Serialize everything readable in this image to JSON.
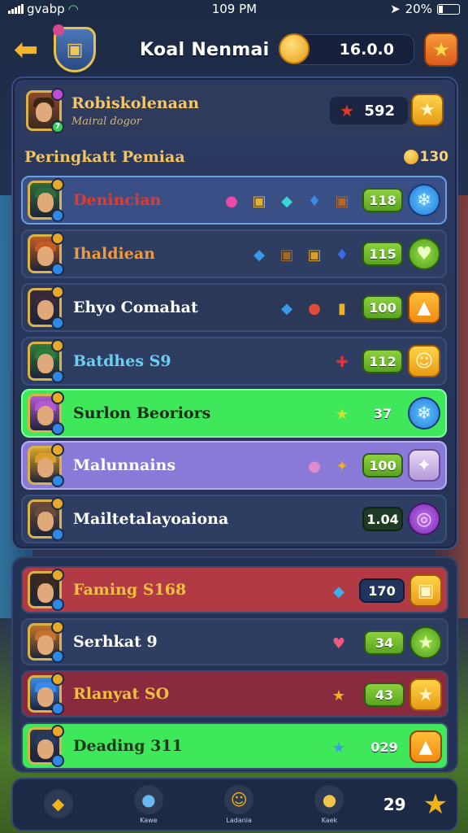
{
  "status_bar": {
    "carrier": "gvabp",
    "time": "109 PM",
    "battery": "20%"
  },
  "header": {
    "title": "Koal Nenmai",
    "coins": "16.0.0"
  },
  "player": {
    "name": "Robiskolenaan",
    "subtitle": "Mairal dogor",
    "score": "592"
  },
  "ranking": {
    "title": "Peringkatt Pemiaa",
    "count": "130"
  },
  "rows": [
    {
      "name": "Denincian",
      "value": "118",
      "name_color": "#e6392c",
      "row_bg": "#3a4f86",
      "border": "#6aa0e0",
      "button": "blue",
      "button_icon": "snowflake-icon",
      "button_glyph": "❄",
      "value_style": "green",
      "avatar_tone": "#2f6a3a",
      "items": [
        {
          "icon": "donut-icon",
          "glyph": "●",
          "color": "#e84aa8"
        },
        {
          "icon": "chest-icon",
          "glyph": "▣",
          "color": "#e0b23a"
        },
        {
          "icon": "cube-icon",
          "glyph": "◆",
          "color": "#3ad6d6"
        },
        {
          "icon": "gem-icon",
          "glyph": "♦",
          "color": "#3a8ae8"
        },
        {
          "icon": "box-icon",
          "glyph": "▣",
          "color": "#b06a2a"
        }
      ]
    },
    {
      "name": "Ihaldiean",
      "value": "115",
      "name_color": "#f29a3a",
      "row_bg": "#2e3d62",
      "border": "#3b4d7a",
      "button": "green",
      "button_icon": "heart-icon",
      "button_glyph": "♥",
      "value_style": "green",
      "avatar_tone": "#c25a22",
      "items": [
        {
          "icon": "cube-icon",
          "glyph": "◆",
          "color": "#3a9ae8"
        },
        {
          "icon": "chest-icon",
          "glyph": "▣",
          "color": "#a06a2a"
        },
        {
          "icon": "chest-icon",
          "glyph": "▣",
          "color": "#d6a02a"
        },
        {
          "icon": "gem-icon",
          "glyph": "♦",
          "color": "#3a6ae8"
        }
      ]
    },
    {
      "name": "Ehyo Comahat",
      "value": "100",
      "name_color": "#ffffff",
      "row_bg": "#2b3858",
      "border": "#3b4d7a",
      "button": "orange",
      "button_icon": "up-arrow-icon",
      "button_glyph": "▲",
      "value_style": "green",
      "avatar_tone": "#3a2a3a",
      "items": [
        {
          "icon": "cube-icon",
          "glyph": "◆",
          "color": "#3a9ae8"
        },
        {
          "icon": "potion-icon",
          "glyph": "●",
          "color": "#e24a3a"
        },
        {
          "icon": "barrel-icon",
          "glyph": "▮",
          "color": "#e8b22a"
        }
      ]
    },
    {
      "name": "Batdhes S9",
      "value": "112",
      "name_color": "#6ad0f2",
      "row_bg": "#2e3d62",
      "border": "#3b4d7a",
      "button": "gold",
      "button_icon": "smile-icon",
      "button_glyph": "☺",
      "value_style": "green",
      "avatar_tone": "#2f7a3a",
      "items": [
        {
          "icon": "gift-icon",
          "glyph": "✚",
          "color": "#e2323a"
        }
      ]
    },
    {
      "name": "Surlon Beoriors",
      "value": "37",
      "name_color": "#1e2a1a",
      "row_bg": "#3ee85a",
      "border": "#8affa0",
      "button": "blue",
      "button_icon": "snowflake-icon",
      "button_glyph": "❄",
      "value_style": "none",
      "avatar_tone": "#b25ad2",
      "items": [
        {
          "icon": "star-icon",
          "glyph": "★",
          "color": "#d6e02a"
        }
      ]
    },
    {
      "name": "Malunnains",
      "value": "100",
      "name_color": "#ffffff",
      "row_bg": "#8a7ad8",
      "border": "#b9aef0",
      "button": "lilac",
      "button_icon": "star-icon",
      "button_glyph": "✦",
      "value_style": "green",
      "avatar_tone": "#d8a02a",
      "items": [
        {
          "icon": "ball-icon",
          "glyph": "●",
          "color": "#e08ad0"
        },
        {
          "icon": "sword-icon",
          "glyph": "✦",
          "color": "#e8b22a"
        }
      ]
    },
    {
      "name": "Mailtetalayoaiona",
      "value": "1.04",
      "name_color": "#ffffff",
      "row_bg": "#2e3d62",
      "border": "#3b4d7a",
      "button": "purple",
      "button_icon": "ring-icon",
      "button_glyph": "◎",
      "value_style": "dark",
      "avatar_tone": "#6a4a3a",
      "items": []
    }
  ],
  "lower_rows": [
    {
      "name": "Faming S168",
      "value": "170",
      "name_color": "#f2c040",
      "row_bg": "#b23a44",
      "button": "gold",
      "button_icon": "chest-icon",
      "button_glyph": "▣",
      "value_style": "blue",
      "avatar_tone": "#3a2a20",
      "items": [
        {
          "icon": "cube-icon",
          "glyph": "◆",
          "color": "#3ab0e8"
        }
      ]
    },
    {
      "name": "Serhkat 9",
      "value": "34",
      "name_color": "#ffffff",
      "row_bg": "#2e3d62",
      "button": "green",
      "button_icon": "star-icon",
      "button_glyph": "★",
      "value_style": "green",
      "avatar_tone": "#c2722a",
      "items": [
        {
          "icon": "heart-icon",
          "glyph": "♥",
          "color": "#f05a7a"
        }
      ]
    },
    {
      "name": "Rlanyat SO",
      "value": "43",
      "name_color": "#f2c040",
      "row_bg": "#8a2a3e",
      "button": "gold",
      "button_icon": "star-icon",
      "button_glyph": "★",
      "value_style": "green",
      "avatar_tone": "#3a8ae8",
      "items": [
        {
          "icon": "star-icon",
          "glyph": "★",
          "color": "#f2b21a"
        }
      ]
    },
    {
      "name": "Deading 311",
      "value": "029",
      "name_color": "#1e3a1a",
      "row_bg": "#3ee85a",
      "button": "orange",
      "button_icon": "lock-icon",
      "button_glyph": "▲",
      "value_style": "none",
      "avatar_tone": "#2a3a5a",
      "items": [
        {
          "icon": "star-icon",
          "glyph": "★",
          "color": "#3a9ae8"
        }
      ]
    }
  ],
  "nav": {
    "items": [
      {
        "icon": "home-icon",
        "glyph": "◆",
        "label": "",
        "color": "#f2b21a"
      },
      {
        "icon": "globe-icon",
        "glyph": "●",
        "label": "Kawe",
        "color": "#6ab8f0"
      },
      {
        "icon": "smile-icon",
        "glyph": "☺",
        "label": "Ladania",
        "color": "#f2b21a"
      },
      {
        "icon": "coin-icon",
        "glyph": "●",
        "label": "Kaek",
        "color": "#f2c44a"
      }
    ],
    "count": "29"
  }
}
